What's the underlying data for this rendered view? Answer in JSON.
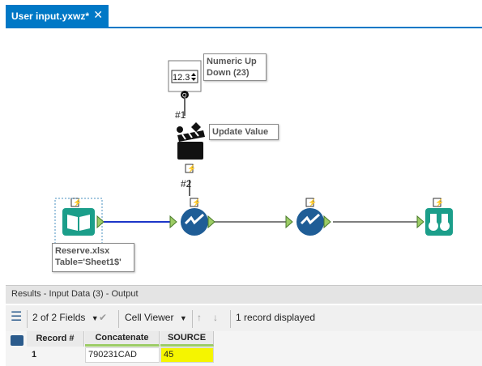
{
  "tab": {
    "title": "User input.yxwz*",
    "close": "✕"
  },
  "canvas": {
    "annotations": {
      "numeric": "Numeric Up\nDown (23)",
      "update": "Update Value",
      "input": "Reserve.xlsx\nTable='Sheet1$'"
    },
    "numeric_value": "12.3",
    "labels": {
      "one": "#1",
      "two": "#2"
    }
  },
  "results": {
    "header": "Results - Input Data (3) - Output",
    "fields": "2 of 2 Fields",
    "viewer": "Cell Viewer",
    "records": "1 record displayed",
    "columns": [
      "Record #",
      "Concatenate",
      "SOURCE"
    ],
    "row": {
      "record": "1",
      "concatenate": "790231CAD",
      "source": "45"
    }
  },
  "colors": {
    "accent": "#0078c6",
    "tool_blue": "#1f5d96",
    "teal": "#1b9e8a",
    "highlight": "#f5f500"
  }
}
